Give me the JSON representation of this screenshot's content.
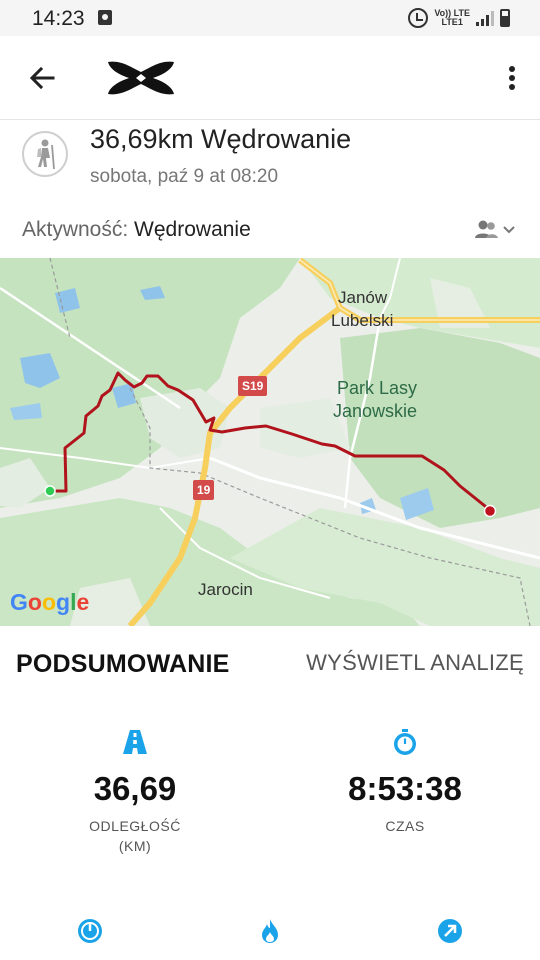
{
  "status_bar": {
    "time": "14:23",
    "network_top": "Vo)) LTE",
    "network_bottom": "LTE1"
  },
  "app_bar": {
    "back_icon": "arrow-left-icon",
    "logo": "under-armour-logo",
    "more_icon": "more-vertical-icon"
  },
  "workout": {
    "icon": "hiker-icon",
    "title": "36,69km Wędrowanie",
    "subtitle": "sobota, paź 9 at 08:20",
    "activity_label": "Aktywność:",
    "activity_value": "Wędrowanie",
    "privacy_icon": "friends-privacy-icon"
  },
  "map": {
    "labels": {
      "janow": "Janów",
      "lubelski": "Lubelski",
      "park_line1": "Park Lasy",
      "park_line2": "Janowskie",
      "jarocin": "Jarocin",
      "road_s19": "S19",
      "road_19": "19"
    },
    "google_logo": [
      "G",
      "o",
      "o",
      "g",
      "l",
      "e"
    ],
    "colors": {
      "route": "#b0131c",
      "start_marker": "#2ecc55",
      "end_marker": "#c0111f",
      "forest": "#c8e6c2",
      "highway": "#f6cf5c"
    }
  },
  "summary": {
    "heading": "PODSUMOWANIE",
    "analysis_link": "WYŚWIETL ANALIZĘ",
    "distance_icon": "road-icon",
    "distance_value": "36,69",
    "distance_label_line1": "ODLEGŁOŚĆ",
    "distance_label_line2": "(KM)",
    "time_icon": "stopwatch-icon",
    "time_value": "8:53:38",
    "time_label": "CZAS",
    "bottom_icons": [
      "gauge-icon",
      "flame-icon",
      "arrow-up-right-icon"
    ],
    "accent_color": "#1aa3e8"
  }
}
